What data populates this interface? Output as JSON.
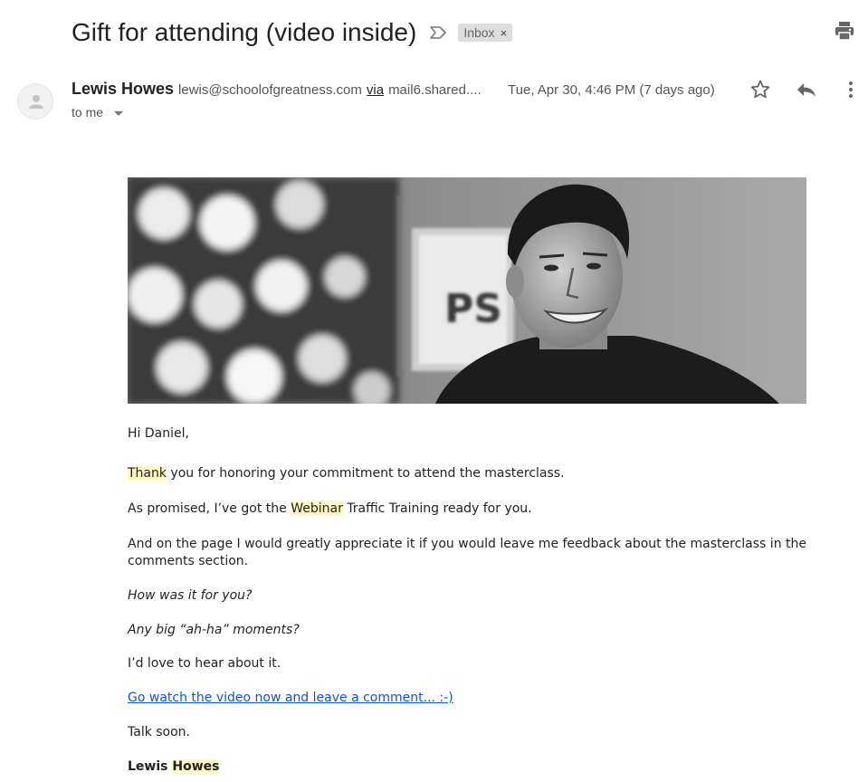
{
  "email": {
    "subject": "Gift for attending (video inside)",
    "label": "Inbox",
    "label_remove": "×",
    "importance_icon": "importance-marker-icon",
    "print_icon": "print-icon",
    "sender": {
      "name": "Lewis Howes",
      "email": "lewis@schoolofgreatness.com",
      "via_label": "via",
      "via_domain": "mail6.shared....",
      "avatar_icon": "default-person-avatar-icon"
    },
    "date": "Tue, Apr 30, 4:46 PM (7 days ago)",
    "actions": {
      "star_icon": "star-icon",
      "reply_icon": "reply-icon",
      "more_icon": "more-vertical-icon"
    },
    "recipients": "to me",
    "hero_image": "black-and-white-portrait-photo"
  },
  "body": {
    "greeting": "Hi Daniel,",
    "p1_hl": "Thank",
    "p1_rest": " you for honoring your commitment to attend the masterclass.",
    "p2_pre": "As promised, I’ve got the ",
    "p2_hl": "Webinar",
    "p2_post": " Traffic Training ready for you.",
    "p3": "And on the page I would greatly appreciate it if you would leave me feedback about the masterclass in the comments section.",
    "q1": "How was it for you?",
    "q2": "Any big “ah-ha” moments?",
    "p4": "I’d love to hear about it.",
    "link": "Go watch the video now and leave a comment... :-)",
    "closing": "Talk soon.",
    "sig_first": "Lewis ",
    "sig_last": "Howes"
  },
  "colors": {
    "highlight": "#fff8c5",
    "link": "#1155cc",
    "label_bg": "#dddddd"
  }
}
